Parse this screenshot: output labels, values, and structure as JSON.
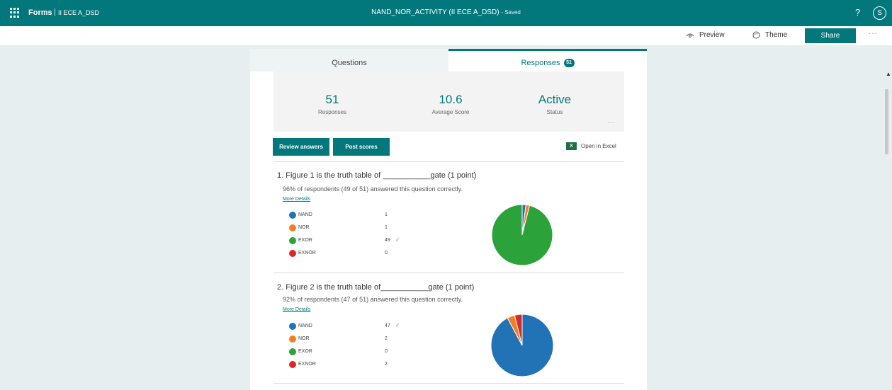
{
  "topbar": {
    "app_name": "Forms",
    "separator": "|",
    "group_name": "II ECE A_DSD",
    "form_title": "NAND_NOR_ACTIVITY (II ECE A_DSD)",
    "save_status": "- Saved",
    "help": "?",
    "user_initial": "S"
  },
  "commands": {
    "preview": "Preview",
    "theme": "Theme",
    "share": "Share",
    "more": "···"
  },
  "tabs": {
    "questions": "Questions",
    "responses": "Responses",
    "responses_count": "51"
  },
  "summary": {
    "responses_value": "51",
    "responses_label": "Responses",
    "avg_value": "10.6",
    "avg_label": "Average Score",
    "status_value": "Active",
    "status_label": "Status",
    "more": "···"
  },
  "actions": {
    "review": "Review answers",
    "post": "Post scores",
    "excel": "Open in Excel",
    "excel_icon": "X"
  },
  "colors": {
    "accent": "#03787c",
    "nand": "#2273b5",
    "nor": "#f28022",
    "exor": "#2ba33a",
    "exnor": "#d82a2a"
  },
  "questions": [
    {
      "title": "1.  Figure 1 is the truth table of ___________gate (1 point)",
      "stat": "96% of respondents (49 of 51) answered this question correctly.",
      "link": "More Details",
      "options": [
        {
          "name": "NAND",
          "count": "1",
          "check": ""
        },
        {
          "name": "NOR",
          "count": "1",
          "check": ""
        },
        {
          "name": "EXOR",
          "count": "49",
          "check": "✓"
        },
        {
          "name": "EXNOR",
          "count": "0",
          "check": ""
        }
      ]
    },
    {
      "title": "2.  Figure 2 is the truth table of___________gate (1 point)",
      "stat": "92% of respondents (47 of 51) answered this question correctly.",
      "link": "More Details",
      "options": [
        {
          "name": "NAND",
          "count": "47",
          "check": "✓"
        },
        {
          "name": "NOR",
          "count": "2",
          "check": ""
        },
        {
          "name": "EXOR",
          "count": "0",
          "check": ""
        },
        {
          "name": "EXNOR",
          "count": "2",
          "check": ""
        }
      ]
    }
  ],
  "chart_data": [
    {
      "type": "pie",
      "categories": [
        "NAND",
        "NOR",
        "EXOR",
        "EXNOR"
      ],
      "values": [
        1,
        1,
        49,
        0
      ]
    },
    {
      "type": "pie",
      "categories": [
        "NAND",
        "NOR",
        "EXOR",
        "EXNOR"
      ],
      "values": [
        47,
        2,
        0,
        2
      ]
    }
  ]
}
